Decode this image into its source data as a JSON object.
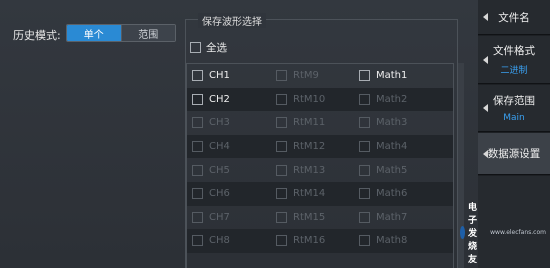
{
  "history": {
    "label": "历史模式:",
    "options": [
      "单个",
      "范围"
    ],
    "selected": "单个"
  },
  "waveform_save": {
    "title": "保存波形选择",
    "select_all": "全选",
    "rows": [
      [
        {
          "label": "CH1",
          "enabled": true
        },
        {
          "label": "RtM9",
          "enabled": false
        },
        {
          "label": "Math1",
          "enabled": true
        }
      ],
      [
        {
          "label": "CH2",
          "enabled": true
        },
        {
          "label": "RtM10",
          "enabled": false
        },
        {
          "label": "Math2",
          "enabled": false
        }
      ],
      [
        {
          "label": "CH3",
          "enabled": false
        },
        {
          "label": "RtM11",
          "enabled": false
        },
        {
          "label": "Math3",
          "enabled": false
        }
      ],
      [
        {
          "label": "CH4",
          "enabled": false
        },
        {
          "label": "RtM12",
          "enabled": false
        },
        {
          "label": "Math4",
          "enabled": false
        }
      ],
      [
        {
          "label": "CH5",
          "enabled": false
        },
        {
          "label": "RtM13",
          "enabled": false
        },
        {
          "label": "Math5",
          "enabled": false
        }
      ],
      [
        {
          "label": "CH6",
          "enabled": false
        },
        {
          "label": "RtM14",
          "enabled": false
        },
        {
          "label": "Math6",
          "enabled": false
        }
      ],
      [
        {
          "label": "CH7",
          "enabled": false
        },
        {
          "label": "RtM15",
          "enabled": false
        },
        {
          "label": "Math7",
          "enabled": false
        }
      ],
      [
        {
          "label": "CH8",
          "enabled": false
        },
        {
          "label": "RtM16",
          "enabled": false
        },
        {
          "label": "Math8",
          "enabled": false
        }
      ]
    ]
  },
  "side_panel": {
    "file_name": {
      "label": "文件名"
    },
    "file_format": {
      "label": "文件格式",
      "value": "二进制"
    },
    "save_range": {
      "label": "保存范围",
      "value": "Main"
    },
    "data_source": {
      "label": "数据源设置"
    }
  },
  "watermark": {
    "text": "电子发烧友",
    "url": "www.elecfans.com"
  },
  "colors": {
    "accent": "#2a8ad4",
    "sub_value": "#3aa0f0",
    "enabled_text": "#efefef",
    "disabled_text": "#5c6269"
  }
}
